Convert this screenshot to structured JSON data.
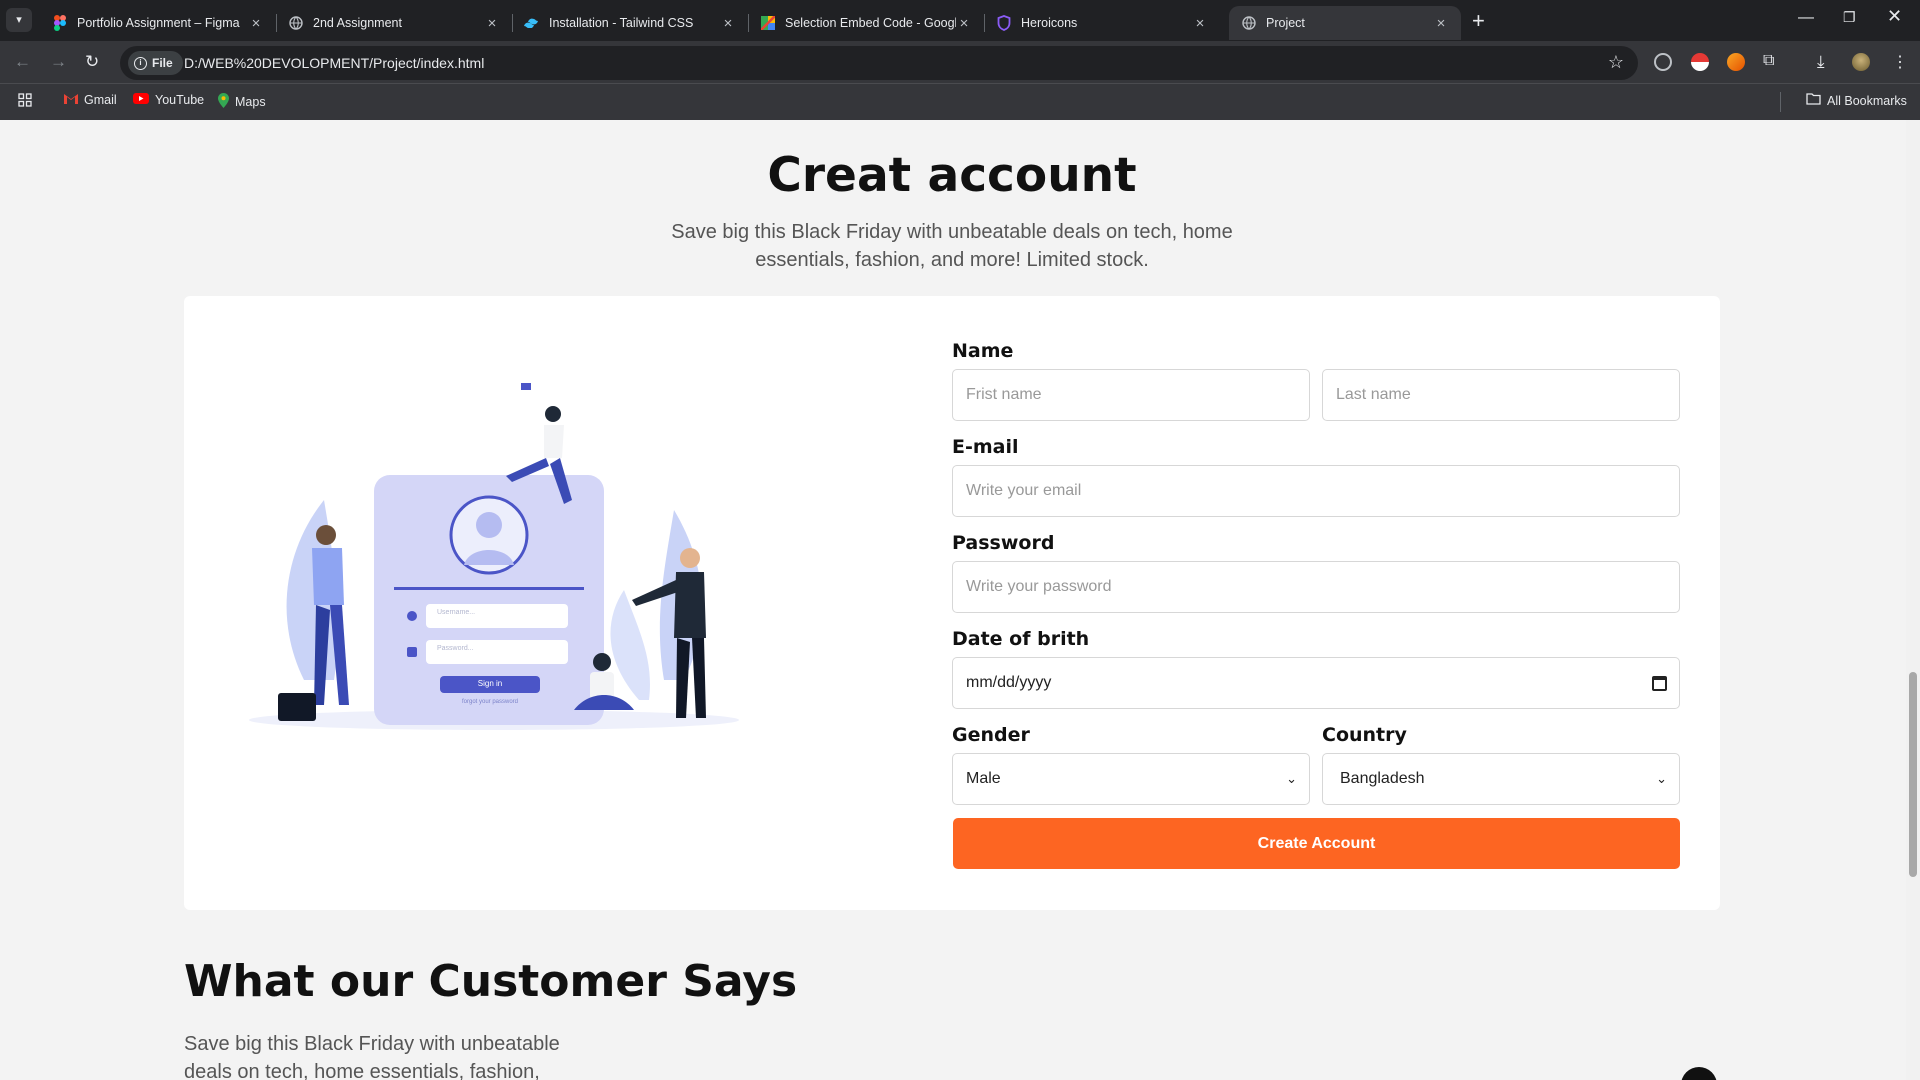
{
  "browser": {
    "tabs": [
      {
        "title": "Portfolio Assignment – Figma",
        "icon": "figma-icon"
      },
      {
        "title": "2nd Assignment",
        "icon": "globe-icon"
      },
      {
        "title": "Installation - Tailwind CSS",
        "icon": "tailwind-icon"
      },
      {
        "title": "Selection Embed Code - Google",
        "icon": "google-maps-icon"
      },
      {
        "title": "Heroicons",
        "icon": "heroicons-shield-icon"
      },
      {
        "title": "Project",
        "icon": "globe-icon"
      }
    ],
    "address": {
      "scheme_label": "File",
      "url": "D:/WEB%20DEVOLOPMENT/Project/index.html"
    },
    "bookmarks": [
      {
        "label": "Gmail",
        "icon": "gmail-icon"
      },
      {
        "label": "YouTube",
        "icon": "youtube-icon"
      },
      {
        "label": "Maps",
        "icon": "maps-pin-icon"
      }
    ],
    "all_bookmarks": "All Bookmarks"
  },
  "hero": {
    "title": "Creat account",
    "subtitle": "Save big this Black Friday with unbeatable deals on tech, home essentials, fashion, and more! Limited stock."
  },
  "form": {
    "name_label": "Name",
    "first_name_placeholder": "Frist name",
    "last_name_placeholder": "Last name",
    "email_label": "E-mail",
    "email_placeholder": "Write your email",
    "password_label": "Password",
    "password_placeholder": "Write your password",
    "dob_label": "Date of brith",
    "dob_placeholder": "mm/dd/yyyy",
    "gender_label": "Gender",
    "gender_value": "Male",
    "country_label": "Country",
    "country_value": "Bangladesh",
    "submit_label": "Create Account",
    "accent_color": "#fd6522"
  },
  "illustration": {
    "username_placeholder": "Username...",
    "password_placeholder": "Password...",
    "signin_label": "Sign in",
    "forgot_text": "forgot your password"
  },
  "testimonials": {
    "title": "What our Customer Says",
    "subtitle": "Save big this Black Friday with unbeatable deals on tech, home essentials, fashion,"
  }
}
